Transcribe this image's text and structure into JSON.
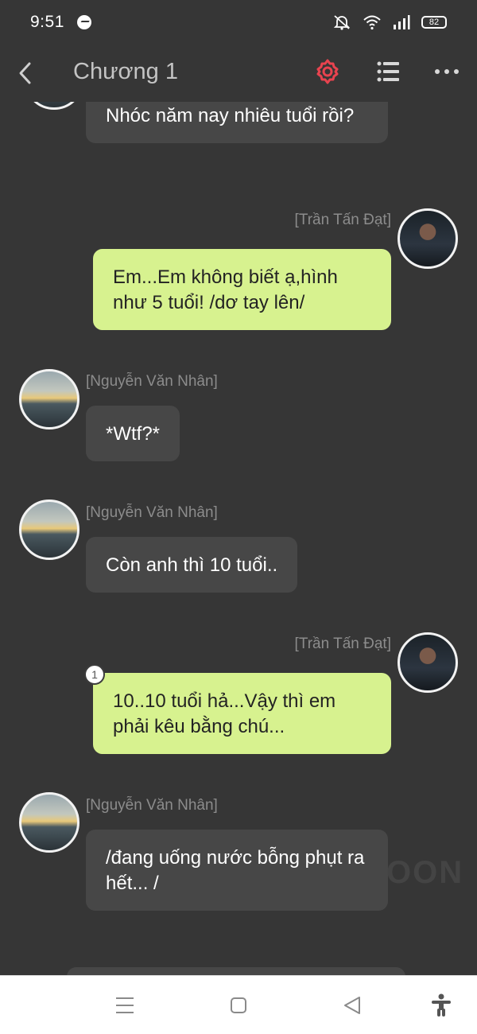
{
  "status_bar": {
    "time": "9:51",
    "battery": "82"
  },
  "header": {
    "title": "Chương 1"
  },
  "colors": {
    "background": "#363636",
    "accent": "#e8434f",
    "bubble_right": "#d7f28f",
    "bubble_left": "#474747"
  },
  "messages": [
    {
      "sender": "",
      "text": "Nhóc năm nay nhiêu tuổi rồi?"
    },
    {
      "sender": "[Trần Tấn Đạt]",
      "text": "Em...Em không biết ạ,hình như 5 tuổi! /dơ tay lên/"
    },
    {
      "sender": "[Nguyễn Văn Nhân]",
      "text": "*Wtf?*"
    },
    {
      "sender": "[Nguyễn Văn Nhân]",
      "text": "Còn anh thì 10 tuổi.."
    },
    {
      "sender": "[Trần Tấn Đạt]",
      "text": "10..10 tuổi hả...Vậy thì em phải kêu bằng chú...",
      "reaction_count": "1"
    },
    {
      "sender": "[Nguyễn Văn Nhân]",
      "text": "/đang uống nước bỗng phụt ra hết... /"
    }
  ],
  "watermark": "OON",
  "icons": {
    "back": "chevron-left-icon",
    "settings": "gear-icon",
    "list": "list-icon",
    "more": "more-horizontal-icon",
    "nav": [
      "menu-icon",
      "home-square-icon",
      "back-triangle-icon",
      "accessibility-icon"
    ]
  }
}
